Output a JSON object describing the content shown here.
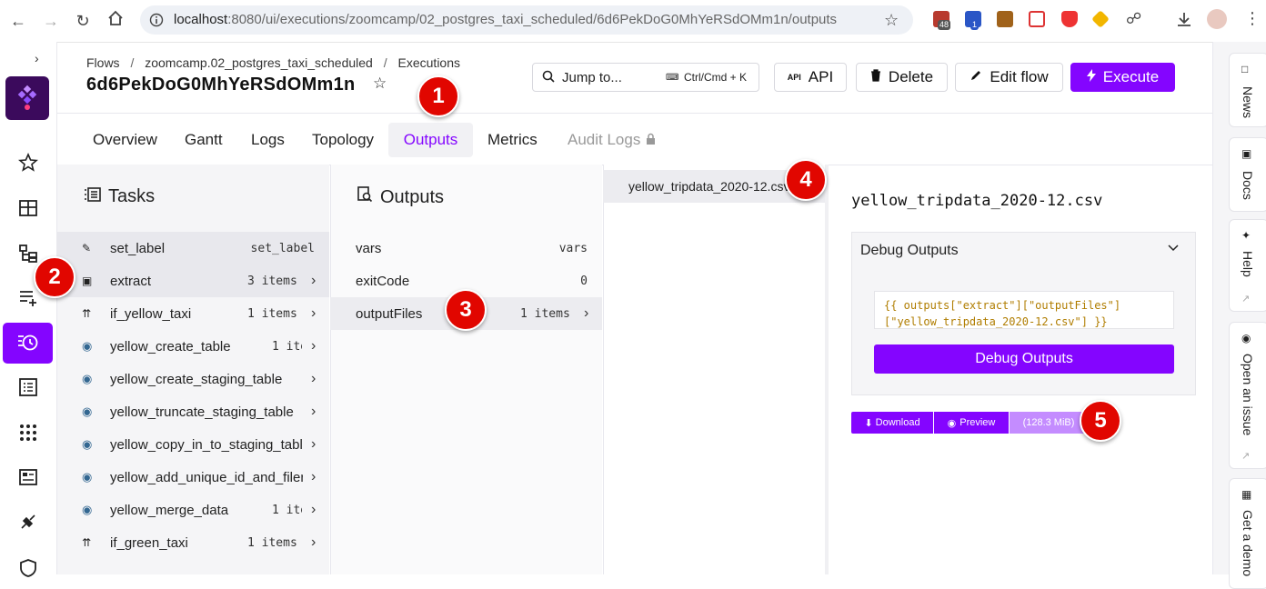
{
  "browser": {
    "url_host": "localhost",
    "url_rest": ":8080/ui/executions/zoomcamp/02_postgres_taxi_scheduled/6d6PekDoG0MhYeRSdOMm1n/outputs",
    "ext_badges": [
      "48",
      "1"
    ]
  },
  "header": {
    "breadcrumb": [
      "Flows",
      "zoomcamp.02_postgres_taxi_scheduled",
      "Executions"
    ],
    "execution_id": "6d6PekDoG0MhYeRSdOMm1n",
    "jump_to": "Jump to...",
    "shortcut": "Ctrl/Cmd + K",
    "api_label": "API",
    "delete_label": "Delete",
    "edit_flow_label": "Edit flow",
    "execute_label": "Execute",
    "accent_color": "#8405ff"
  },
  "tabs": [
    "Overview",
    "Gantt",
    "Logs",
    "Topology",
    "Outputs",
    "Metrics",
    "Audit Logs"
  ],
  "tasks_panel": {
    "title": "Tasks",
    "items": [
      {
        "name": "set_label",
        "meta": "set_label"
      },
      {
        "name": "extract",
        "meta": "3 items"
      },
      {
        "name": "if_yellow_taxi",
        "meta": "1 items"
      },
      {
        "name": "yellow_create_table",
        "meta": "1 ite"
      },
      {
        "name": "yellow_create_staging_table",
        "meta": ""
      },
      {
        "name": "yellow_truncate_staging_table",
        "meta": ""
      },
      {
        "name": "yellow_copy_in_to_staging_table",
        "meta": ""
      },
      {
        "name": "yellow_add_unique_id_and_filen",
        "meta": ""
      },
      {
        "name": "yellow_merge_data",
        "meta": "1 ite"
      },
      {
        "name": "if_green_taxi",
        "meta": "1 items"
      }
    ]
  },
  "outputs_panel": {
    "title": "Outputs",
    "items": [
      {
        "name": "vars",
        "meta": "vars"
      },
      {
        "name": "exitCode",
        "meta": "0"
      },
      {
        "name": "outputFiles",
        "meta": "1 items"
      }
    ]
  },
  "files_panel": {
    "items": [
      "yellow_tripdata_2020-12.csv"
    ]
  },
  "detail": {
    "filename": "yellow_tripdata_2020-12.csv",
    "debug_title": "Debug Outputs",
    "expression_line1": "{{ outputs[\"extract\"][\"outputFiles\"]",
    "expression_line2": "[\"yellow_tripdata_2020-12.csv\"] }}",
    "debug_button": "Debug Outputs",
    "download_label": "Download",
    "preview_label": "Preview",
    "size_label": "(128.3 MiB)"
  },
  "right_rail": [
    "News",
    "Docs",
    "Help",
    "Open an issue",
    "Get a demo"
  ],
  "markers": [
    "1",
    "2",
    "3",
    "4",
    "5"
  ]
}
